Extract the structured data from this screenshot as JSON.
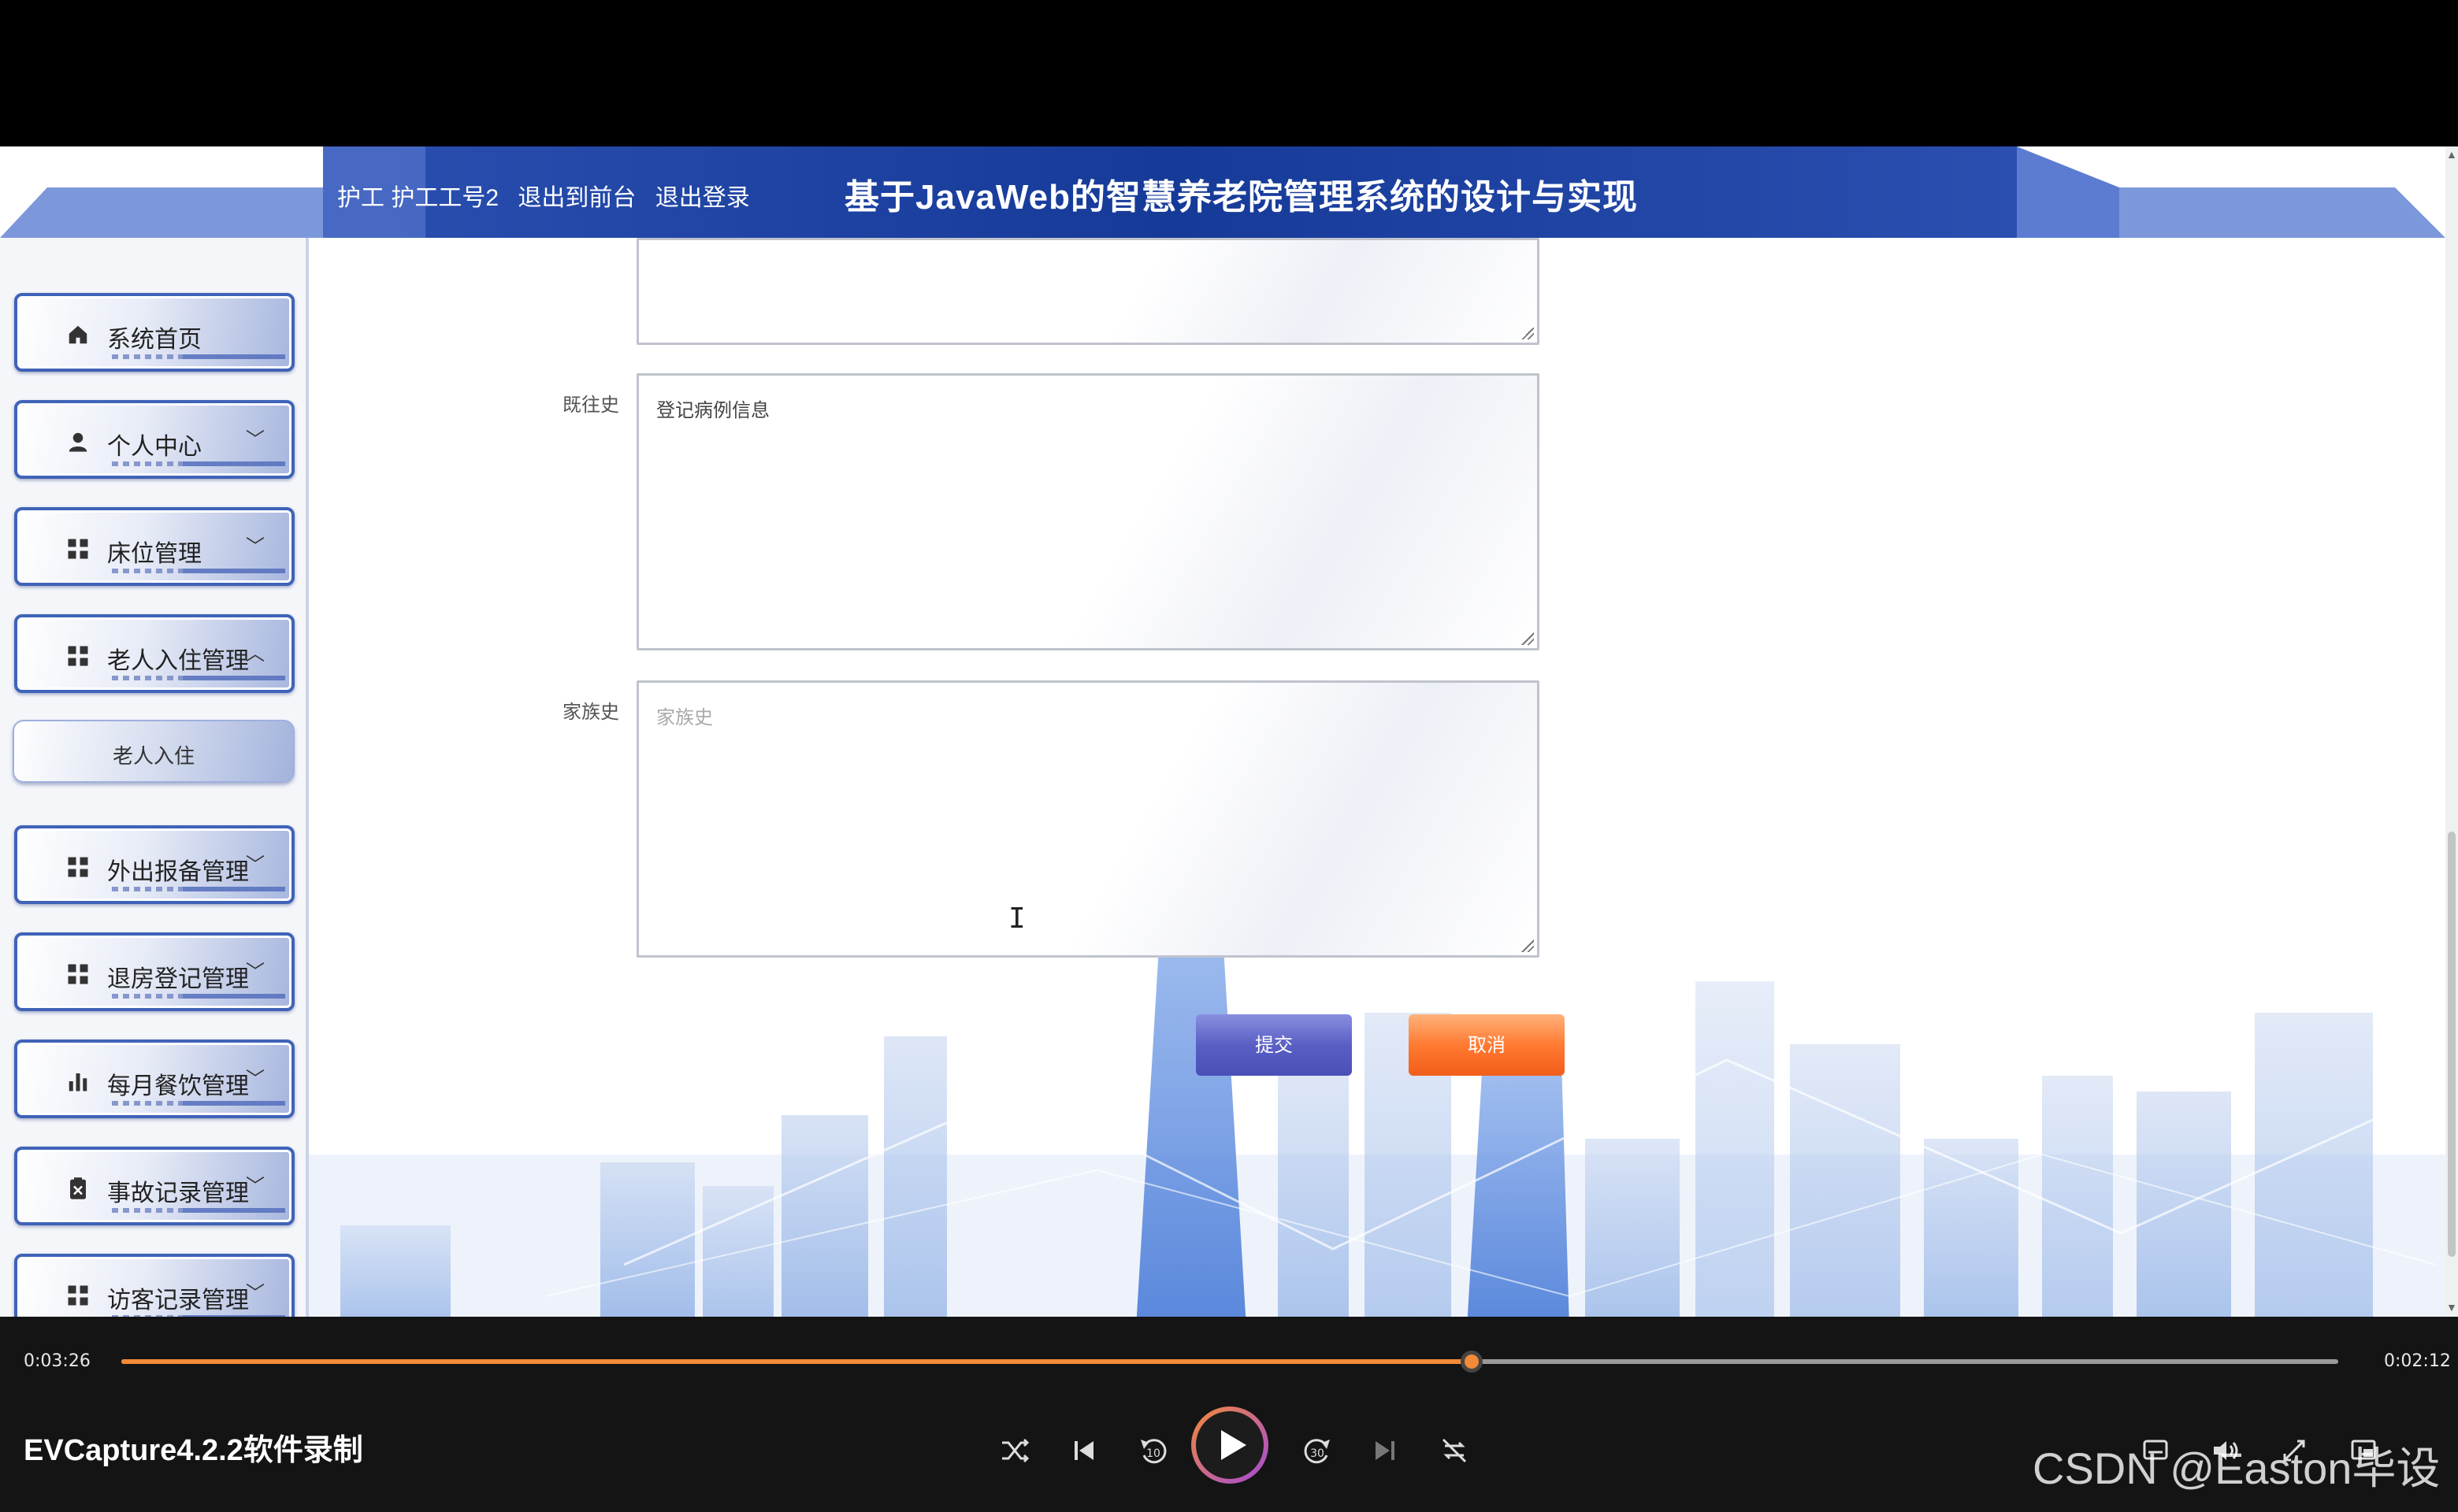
{
  "header": {
    "nav": [
      "护工 护工工号2",
      "退出到前台",
      "退出登录"
    ],
    "title": "基于JavaWeb的智慧养老院管理系统的设计与实现"
  },
  "sidebar": {
    "items": [
      {
        "label": "系统首页",
        "icon": "home-icon",
        "chevron": ""
      },
      {
        "label": "个人中心",
        "icon": "user-icon",
        "chevron": "﹀"
      },
      {
        "label": "床位管理",
        "icon": "grid-icon",
        "chevron": "﹀"
      },
      {
        "label": "老人入住管理",
        "icon": "grid-icon",
        "chevron": "︿"
      },
      {
        "label": "外出报备管理",
        "icon": "grid-icon",
        "chevron": "﹀"
      },
      {
        "label": "退房登记管理",
        "icon": "grid-icon",
        "chevron": "﹀"
      },
      {
        "label": "每月餐饮管理",
        "icon": "bar-chart-icon",
        "chevron": "﹀"
      },
      {
        "label": "事故记录管理",
        "icon": "clipboard-icon",
        "chevron": "﹀"
      },
      {
        "label": "访客记录管理",
        "icon": "grid-icon",
        "chevron": "﹀"
      }
    ],
    "subitem": "老人入住"
  },
  "form": {
    "past_history_label": "既往史",
    "past_history_value": "登记病例信息",
    "family_history_label": "家族史",
    "family_history_placeholder": "家族史",
    "submit": "提交",
    "cancel": "取消"
  },
  "player": {
    "elapsed": "0:03:26",
    "remaining": "0:02:12",
    "progress": 0.609,
    "title": "EVCapture4.2.2软件录制",
    "watermark": "CSDN @Easton毕设"
  },
  "colors": {
    "header": "#1c3f9a",
    "accent_orange": "#f28a38",
    "submit": "#5a5fc4",
    "cancel": "#ff7a32"
  }
}
